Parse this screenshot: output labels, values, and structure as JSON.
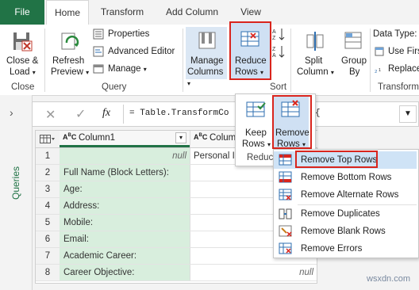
{
  "tabs": [
    "File",
    "Home",
    "Transform",
    "Add Column",
    "View"
  ],
  "ribbon": {
    "close_load": [
      "Close &",
      "Load"
    ],
    "close_group": "Close",
    "refresh": [
      "Refresh",
      "Preview"
    ],
    "properties": "Properties",
    "advanced_editor": "Advanced Editor",
    "manage": "Manage",
    "query_group": "Query",
    "manage_columns": [
      "Manage",
      "Columns"
    ],
    "reduce_rows": [
      "Reduce",
      "Rows"
    ],
    "sort_group": "Sort",
    "split_column": [
      "Split",
      "Column"
    ],
    "group_by": [
      "Group",
      "By"
    ],
    "data_type": "Data Type: T",
    "use_first": "Use Firs",
    "replace": "Replace",
    "transform_group": "Transform"
  },
  "queries_label": "Queries",
  "formula": {
    "fx": "fx",
    "text": "= Table.TransformCo",
    "text_tail": "{"
  },
  "reduce_panel": {
    "keep_rows": [
      "Keep",
      "Rows"
    ],
    "remove_rows": [
      "Remove",
      "Rows"
    ],
    "group": "Reduc"
  },
  "remove_menu": [
    "Remove Top Rows",
    "Remove Bottom Rows",
    "Remove Alternate Rows",
    "Remove Duplicates",
    "Remove Blank Rows",
    "Remove Errors"
  ],
  "grid": {
    "col1_header": "Column1",
    "col2_header": "Colum",
    "rows": [
      {
        "n": "1",
        "c1": "",
        "c1null": "null",
        "c2": "Personal In"
      },
      {
        "n": "2",
        "c1": "Full Name (Block Letters):",
        "c2": ""
      },
      {
        "n": "3",
        "c1": "Age:",
        "c2": ""
      },
      {
        "n": "4",
        "c1": "Address:",
        "c2": ""
      },
      {
        "n": "5",
        "c1": "Mobile:",
        "c2": ""
      },
      {
        "n": "6",
        "c1": "Email:",
        "c2": ""
      },
      {
        "n": "7",
        "c1": "Academic Career:",
        "c2": "null"
      },
      {
        "n": "8",
        "c1": "Career Objective:",
        "c2": "null"
      }
    ]
  },
  "watermark": "wsxdn.com"
}
